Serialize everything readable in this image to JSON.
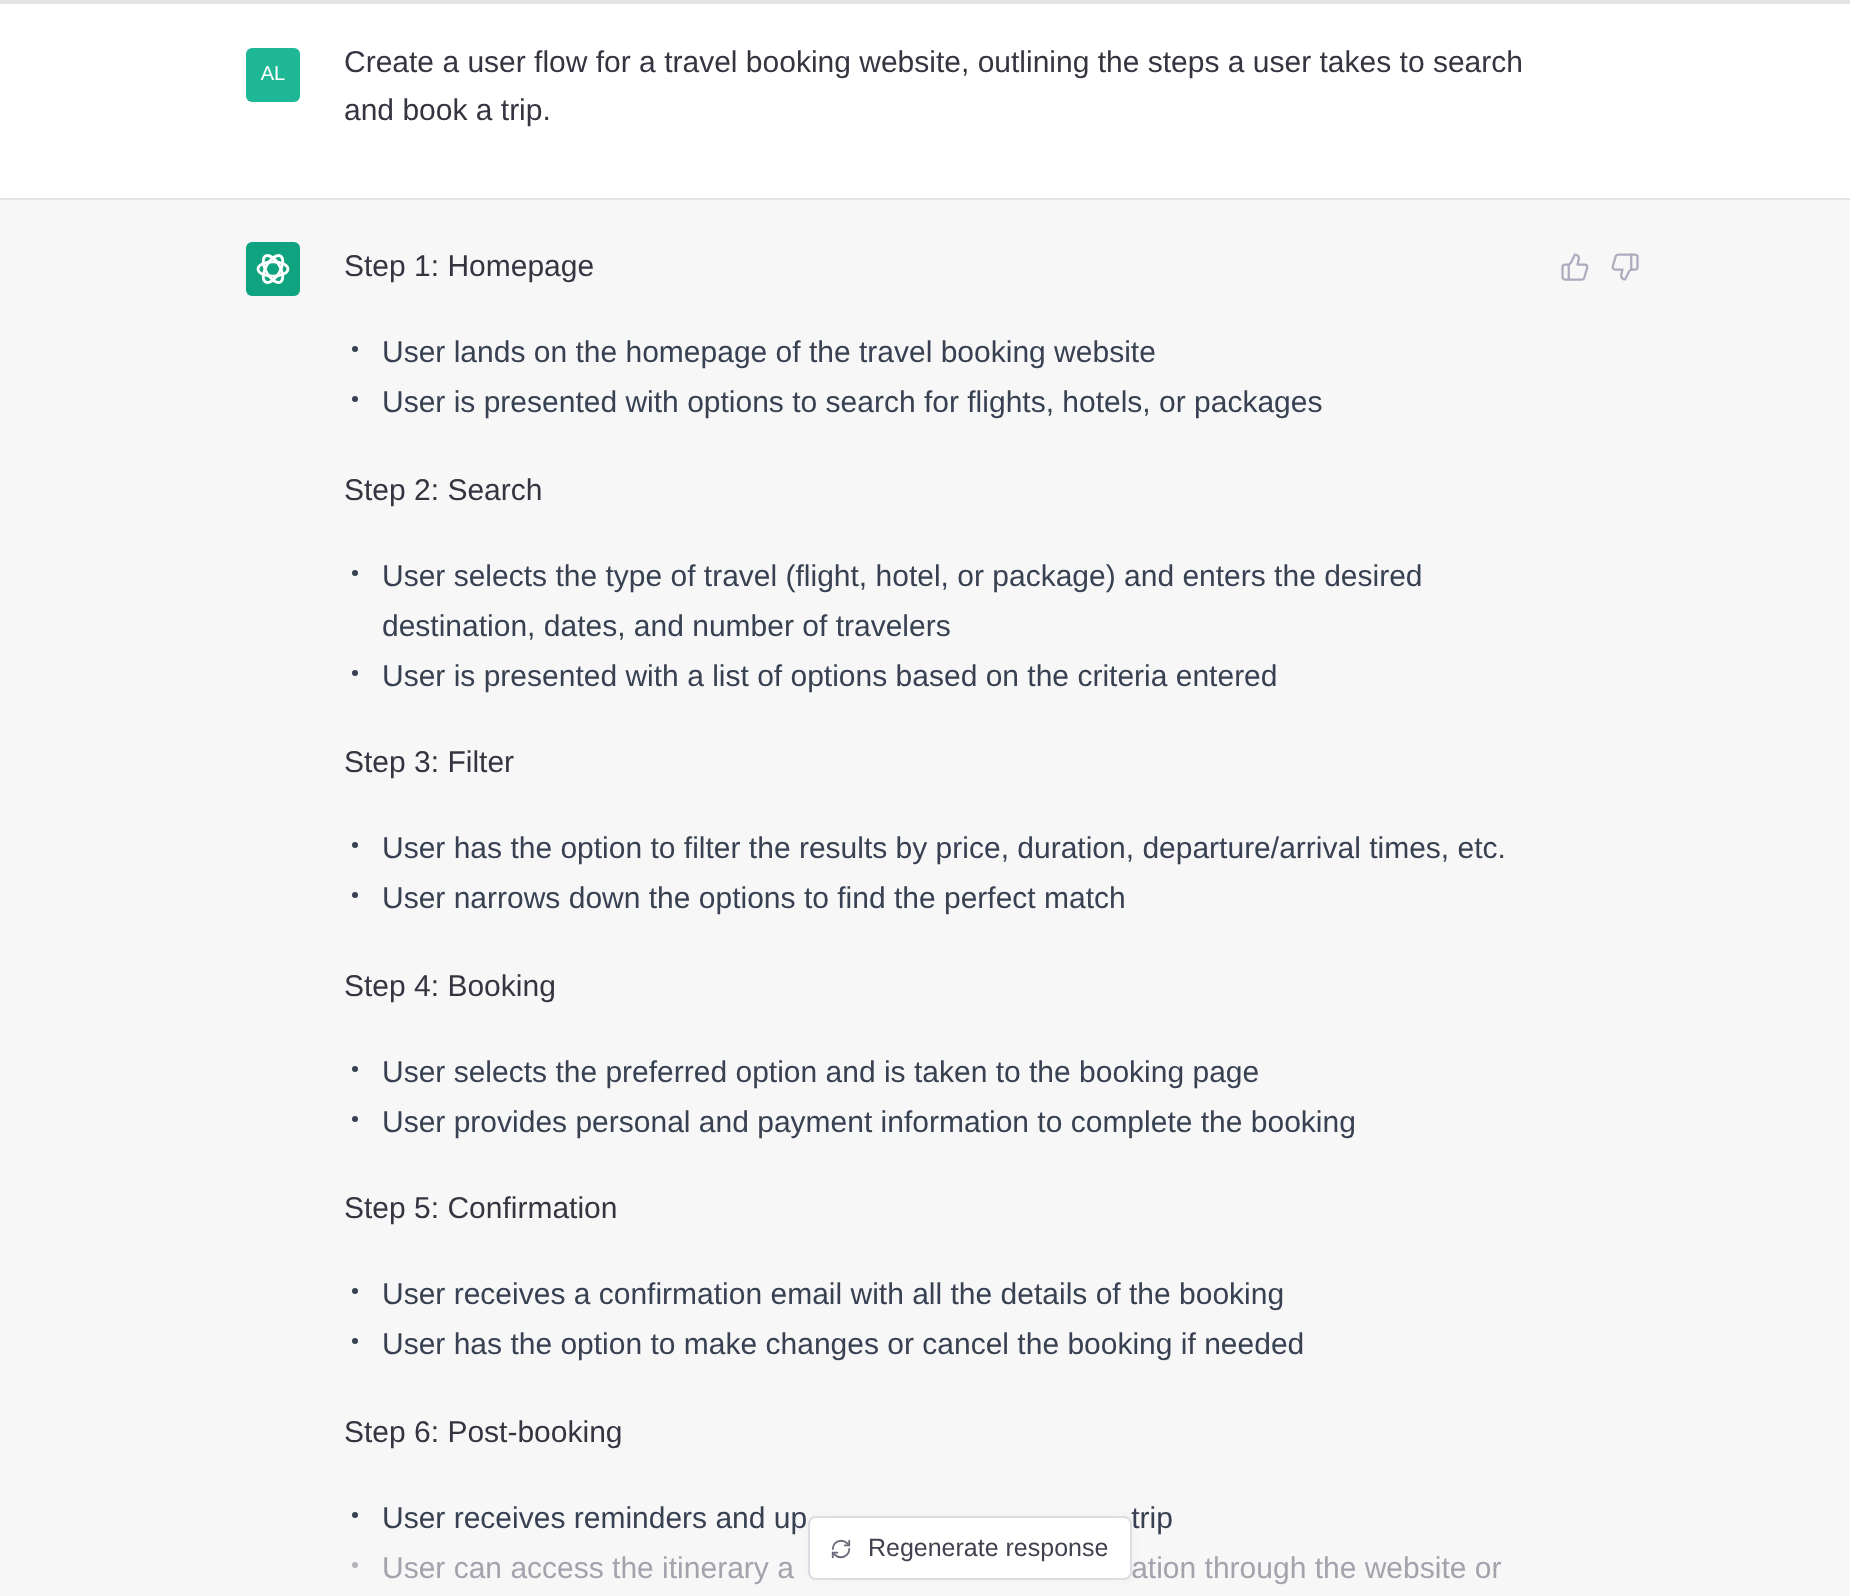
{
  "user_message": {
    "avatar": "AL",
    "text": "Create a user flow for a travel booking website, outlining the steps a user takes to search and book a trip."
  },
  "response": {
    "steps": [
      {
        "heading": "Step 1: Homepage",
        "bullets": [
          {
            "text": "User lands on the homepage of the travel booking website",
            "faded": false
          },
          {
            "text": "User is presented with options to search for flights, hotels, or packages",
            "faded": false
          }
        ]
      },
      {
        "heading": "Step 2: Search",
        "bullets": [
          {
            "text": "User selects the type of travel (flight, hotel, or package) and enters the desired destination, dates, and number of travelers",
            "faded": false
          },
          {
            "text": "User is presented with a list of options based on the criteria entered",
            "faded": false
          }
        ]
      },
      {
        "heading": "Step 3: Filter",
        "bullets": [
          {
            "text": "User has the option to filter the results by price, duration, departure/arrival times, etc.",
            "faded": false
          },
          {
            "text": "User narrows down the options to find the perfect match",
            "faded": false
          }
        ]
      },
      {
        "heading": "Step 4: Booking",
        "bullets": [
          {
            "text": "User selects the preferred option and is taken to the booking page",
            "faded": false
          },
          {
            "text": "User provides personal and payment information to complete the booking",
            "faded": false
          }
        ]
      },
      {
        "heading": "Step 5: Confirmation",
        "bullets": [
          {
            "text": "User receives a confirmation email with all the details of the booking",
            "faded": false
          },
          {
            "text": "User has the option to make changes or cancel the booking if needed",
            "faded": false
          }
        ]
      },
      {
        "heading": "Step 6: Post-booking",
        "bullets": [
          {
            "text": "User receives reminders and up",
            "text_after_button": "trip",
            "faded": false
          },
          {
            "text": "User can access the itinerary a",
            "text_after_button": "ation through the website or",
            "faded": true
          }
        ]
      }
    ]
  },
  "regenerate_button": {
    "label": "Regenerate response"
  }
}
